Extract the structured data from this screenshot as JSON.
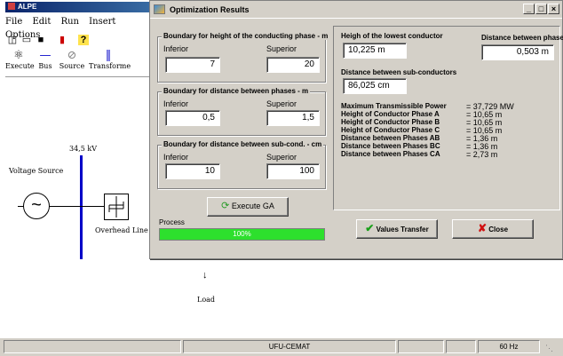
{
  "bg_app": {
    "title": "ALPE",
    "menu": [
      "File",
      "Edit",
      "Run",
      "Insert",
      "Options"
    ],
    "toolbar_icons": [
      "new-icon",
      "open-icon",
      "save-icon",
      "bar-icon",
      "help-icon"
    ],
    "toolbar2": [
      {
        "label": "Execute",
        "icon": "execute-icon"
      },
      {
        "label": "Bus",
        "icon": "bus-icon"
      },
      {
        "label": "Source",
        "icon": "source-icon"
      },
      {
        "label": "Transforme",
        "icon": "transformer-icon"
      }
    ],
    "diagram": {
      "voltage_source": "Voltage Source",
      "bus_kv": "34,5 kV",
      "overhead_line": "Overhead Line",
      "load": "Load"
    }
  },
  "dialog": {
    "title": "Optimization Results",
    "height_group": {
      "title": "Boundary for height of the conducting phase - m",
      "inferior_label": "Inferior",
      "superior_label": "Superior",
      "inferior_value": "7",
      "superior_value": "20"
    },
    "phase_dist_group": {
      "title": "Boundary for distance between phases - m",
      "inferior_label": "Inferior",
      "superior_label": "Superior",
      "inferior_value": "0,5",
      "superior_value": "1,5"
    },
    "subcond_group": {
      "title": "Boundary for distance between sub-cond. - cm",
      "inferior_label": "Inferior",
      "superior_label": "Superior",
      "inferior_value": "10",
      "superior_value": "100"
    },
    "execute_button": "Execute  GA",
    "process_label": "Process",
    "progress_text": "100%",
    "progress_fraction": 1.0,
    "results": {
      "lowest_conductor_label": "Heigh of the lowest conductor",
      "lowest_conductor_value": "10,225 m",
      "distance_phases_label": "Distance between phases",
      "distance_phases_value": "0,503 m",
      "subconductors_label": "Distance between sub-conductors",
      "subconductors_value": "86,025 cm",
      "rows": [
        {
          "label": "Maximum Transmissible Power",
          "value": "= 37,729 MW"
        },
        {
          "label": "Height of Conductor Phase A",
          "value": "= 10,65  m"
        },
        {
          "label": "Height of Conductor Phase B",
          "value": "= 10,65  m"
        },
        {
          "label": "Height of Conductor Phase C",
          "value": "= 10,65  m"
        },
        {
          "label": "Distance between Phases AB",
          "value": "= 1,36  m"
        },
        {
          "label": "Distance between Phases BC",
          "value": "= 1,36  m"
        },
        {
          "label": "Distance between Phases CA",
          "value": "= 2,73  m"
        }
      ]
    },
    "values_transfer_button": "Values Transfer",
    "close_button": "Close"
  },
  "statusbar": {
    "org": "UFU-CEMAT",
    "frequency": "60 Hz"
  },
  "colors": {
    "bus": "#0000c8",
    "progress": "#2de02d",
    "dialog_face": "#d4d0c8"
  }
}
